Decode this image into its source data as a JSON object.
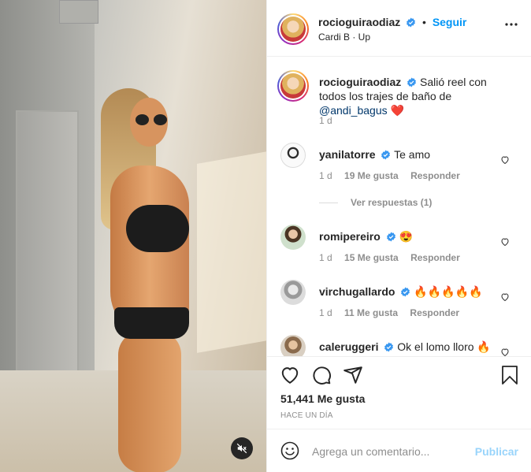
{
  "post": {
    "author": "rocioguiraodiaz",
    "follow_label": "Seguir",
    "separator": "•",
    "audio": "Cardi B · Up"
  },
  "caption": {
    "username": "rocioguiraodiaz",
    "text_before": "Salió reel con todos los trajes de baño de ",
    "mention": "@andi_bagus",
    "emoji": "❤️",
    "time": "1 d"
  },
  "comments": [
    {
      "username": "yanilatorre",
      "text": "Te amo",
      "time": "1 d",
      "likes": "19 Me gusta",
      "reply": "Responder",
      "replies": "Ver respuestas (1)"
    },
    {
      "username": "romipereiro",
      "text": "😍",
      "time": "1 d",
      "likes": "15 Me gusta",
      "reply": "Responder"
    },
    {
      "username": "virchugallardo",
      "text": "🔥🔥🔥🔥🔥",
      "time": "1 d",
      "likes": "11 Me gusta",
      "reply": "Responder"
    },
    {
      "username": "caleruggeri",
      "text": "Ok el lomo lloro 🔥"
    }
  ],
  "footer": {
    "likes": "51,441 Me gusta",
    "posted_ago": "HACE UN DÍA"
  },
  "composer": {
    "placeholder": "Agrega un comentario...",
    "publish": "Publicar"
  },
  "colors": {
    "accent": "#0095f6",
    "text": "#262626",
    "muted": "#8e8e8e",
    "verified": "#3897f0"
  },
  "icons": [
    "verified-badge-icon",
    "more-options-icon",
    "heart-icon",
    "comment-icon",
    "share-icon",
    "bookmark-icon",
    "emoji-icon",
    "mute-icon"
  ]
}
